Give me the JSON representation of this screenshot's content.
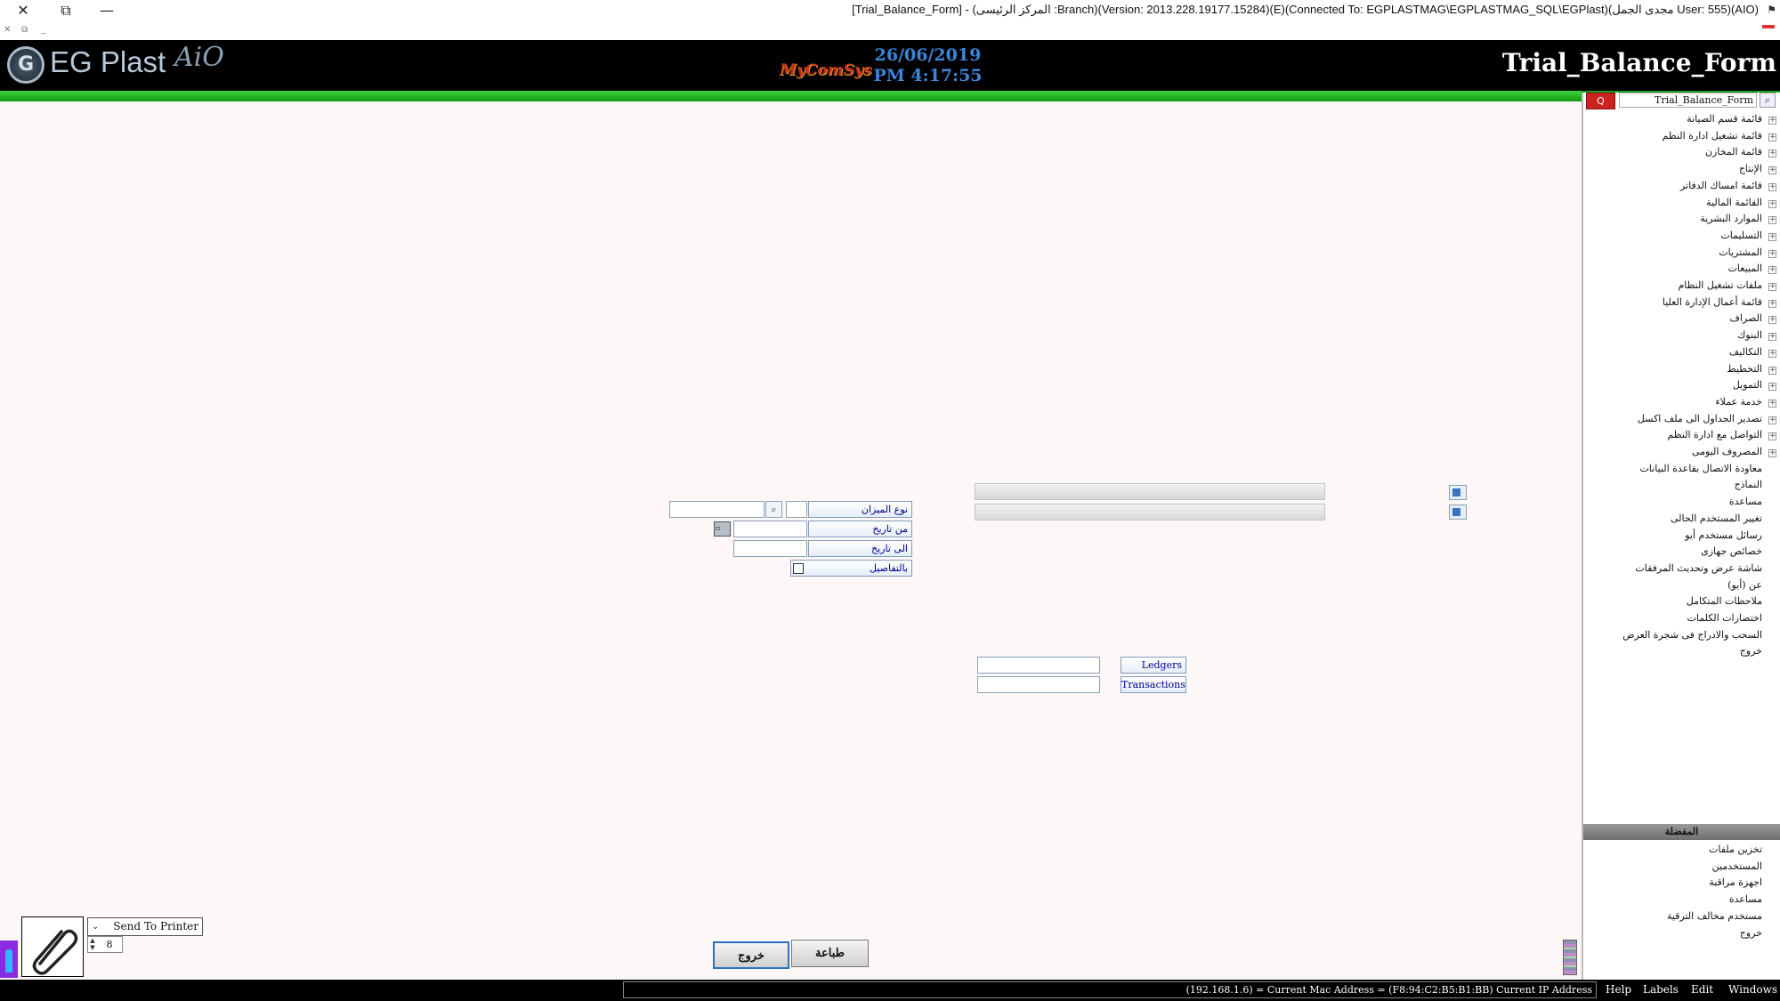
{
  "window": {
    "title": "[Trial_Balance_Form] - (المركز الرئيسى :Branch)(Version: 2013.228.19177.15284)(E)(Connected To: EGPLASTMAG\\EGPLASTMAG_SQL\\EGPlast)(مجدى الجمل User: 555)(AIO)",
    "close_glyph": "✕",
    "restore_glyph": "⧉",
    "minimize_glyph": "—",
    "sub_close_glyph": "✕",
    "sub_restore_glyph": "⧉",
    "sub_minimize_glyph": "_",
    "flag_glyph": "⚑"
  },
  "header": {
    "logo_mark": "G",
    "logo_text": "EG Plast",
    "logo_sub": "AiO",
    "brand2": "MyComSys",
    "date": "26/06/2019",
    "time": "PM 4:17:55",
    "form_name": "Trial_Balance_Form"
  },
  "sidebar": {
    "search_button": "Q",
    "search_value": "Trial_Balance_Form",
    "search_mag": "⌕",
    "items": [
      {
        "label": "قائمة قسم الصيانة",
        "expand": "+"
      },
      {
        "label": "قائمة تشغيل ادارة النظم",
        "expand": "+"
      },
      {
        "label": "قائمة المخازن",
        "expand": "+"
      },
      {
        "label": "الإنتاج",
        "expand": "+"
      },
      {
        "label": "قائمة امساك الدفاتر",
        "expand": "+"
      },
      {
        "label": "القائمة المالية",
        "expand": "+"
      },
      {
        "label": "الموارد البشرية",
        "expand": "+"
      },
      {
        "label": "التسليمات",
        "expand": "+"
      },
      {
        "label": "المشتريات",
        "expand": "+"
      },
      {
        "label": "المبيعات",
        "expand": "+"
      },
      {
        "label": "ملفات تشغيل النظام",
        "expand": "+"
      },
      {
        "label": "قائمة أعمال الإدارة العليا",
        "expand": "+"
      },
      {
        "label": "الصراف",
        "expand": "+"
      },
      {
        "label": "البنوك",
        "expand": "+"
      },
      {
        "label": "التكاليف",
        "expand": "+"
      },
      {
        "label": "التخطيط",
        "expand": "+"
      },
      {
        "label": "التمويل",
        "expand": "+"
      },
      {
        "label": "خدمة عملاء",
        "expand": "+"
      },
      {
        "label": "تصدير الجداول الى ملف اكسل",
        "expand": "+"
      },
      {
        "label": "التواصل مع ادارة النظم",
        "expand": "+"
      },
      {
        "label": "المصروف اليومى",
        "expand": "+"
      },
      {
        "label": "معاودة الاتصال بقاعدة البيانات"
      },
      {
        "label": "النماذج"
      },
      {
        "label": "مساعدة"
      },
      {
        "label": "تغيير المستخدم الحالى"
      },
      {
        "label": "رسائل مستخدم أيو"
      },
      {
        "label": "خصائص جهازى"
      },
      {
        "label": "شاشة عرض وتحديث المرفقات"
      },
      {
        "label": "عن (أيو)"
      },
      {
        "label": "ملاحظات المتكامل"
      },
      {
        "label": "اختصارات الكلمات"
      },
      {
        "label": "السحب والادراج فى شجرة العرض"
      },
      {
        "label": "خروج"
      }
    ],
    "favorites_title": "المفضلة",
    "favorites": [
      {
        "label": "تخزين ملفات"
      },
      {
        "label": "المستخدمين"
      },
      {
        "label": "اجهزة مراقبة"
      },
      {
        "label": "مساعدة"
      },
      {
        "label": "مستخدم مخالف الترقية"
      },
      {
        "label": "خروج"
      }
    ]
  },
  "form": {
    "balance_type_label": "نوع الميزان",
    "balance_type_lookup": "⌕",
    "from_date_label": "من تاريخ",
    "calendar_glyph": "▫",
    "to_date_label": "الى تاريخ",
    "details_label": "بالتفاصيل",
    "ledgers_label": "Ledgers",
    "transactions_label": "Transactions"
  },
  "footer": {
    "print_target": "Send To Printer",
    "print_arrow": "⌄",
    "copies": "8",
    "spin_up": "▲",
    "spin_down": "▼",
    "exit_label": "خروج",
    "print_label": "طباعة"
  },
  "statusbar": {
    "ip_text": "(192.168.1.6) = Current Mac Address = (F8:94:C2:B5:B1:BB) Current IP Address",
    "menus": [
      "Help",
      "Labels",
      "Edit",
      "Windows"
    ]
  }
}
